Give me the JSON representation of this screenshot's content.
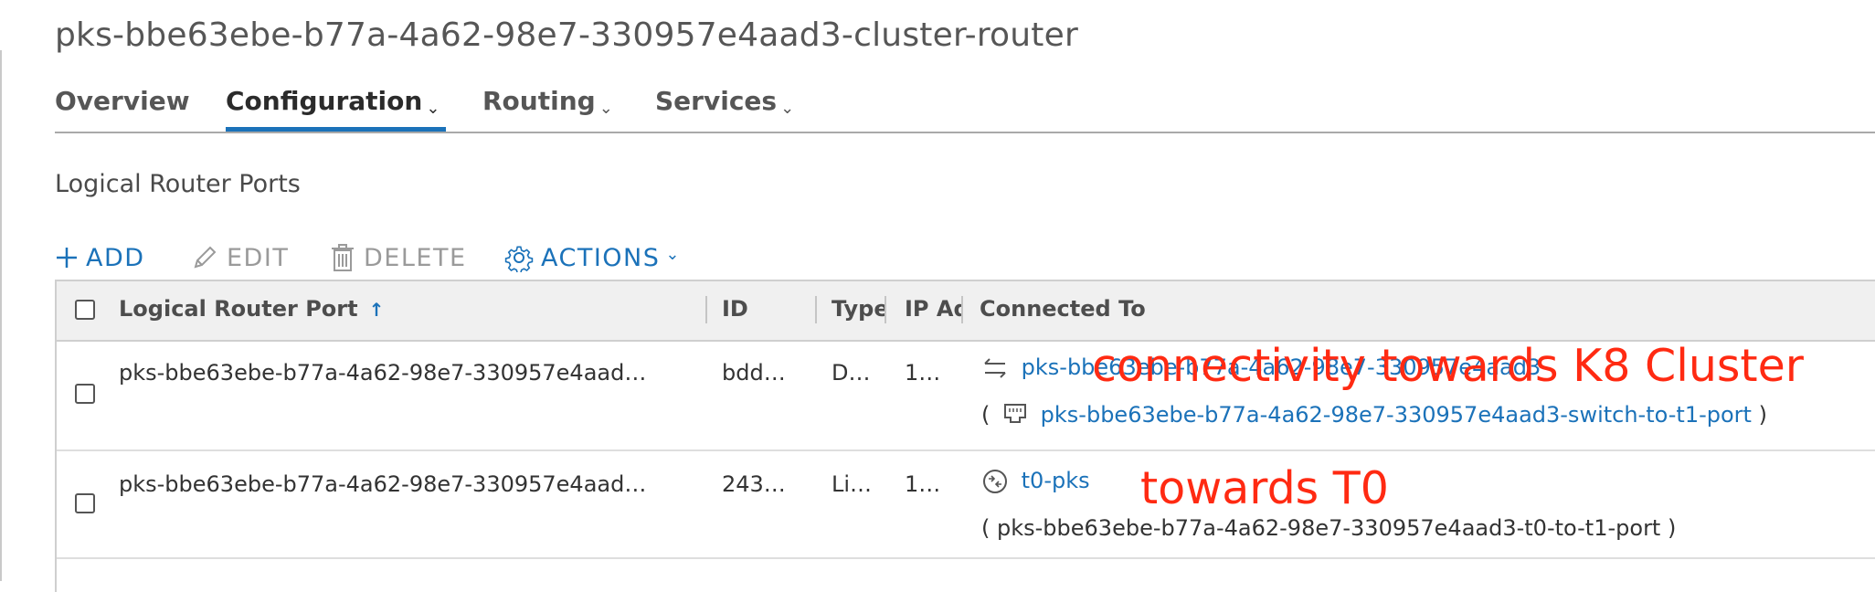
{
  "page_title": "pks-bbe63ebe-b77a-4a62-98e7-330957e4aad3-cluster-router",
  "tabs": [
    {
      "label": "Overview",
      "has_chevron": false
    },
    {
      "label": "Configuration",
      "has_chevron": true,
      "active": true
    },
    {
      "label": "Routing",
      "has_chevron": true
    },
    {
      "label": "Services",
      "has_chevron": true
    }
  ],
  "section_title": "Logical Router Ports",
  "toolbar": {
    "add": "ADD",
    "edit": "EDIT",
    "delete": "DELETE",
    "actions": "ACTIONS"
  },
  "table": {
    "columns": [
      "Logical Router Port",
      "ID",
      "Type",
      "IP Ad",
      "Connected To"
    ],
    "rows": [
      {
        "name": "pks-bbe63ebe-b77a-4a62-98e7-330957e4aad…",
        "id": "bdd…",
        "type": "D…",
        "ip": "1…",
        "connected_link": "pks-bbe63ebe-b77a-4a62-98e7-330957e4aad3",
        "connected_sub_open": "(",
        "connected_sub_link": "pks-bbe63ebe-b77a-4a62-98e7-330957e4aad3-switch-to-t1-port",
        "connected_sub_close": ")"
      },
      {
        "name": "pks-bbe63ebe-b77a-4a62-98e7-330957e4aad…",
        "id": "243…",
        "type": "Li…",
        "ip": "1…",
        "connected_link": "t0-pks",
        "connected_sub_text": "( pks-bbe63ebe-b77a-4a62-98e7-330957e4aad3-t0-to-t1-port )"
      }
    ]
  },
  "annotations": {
    "k8": "connectivity towards K8 Cluster",
    "t0": "towards T0"
  },
  "colors": {
    "accent": "#1b72b9",
    "annotation": "#ff2a12"
  }
}
